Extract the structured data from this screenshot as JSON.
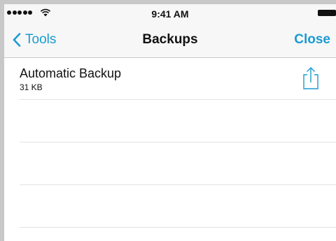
{
  "status_bar": {
    "time": "9:41 AM",
    "signal_icon": "signal-dots-icon",
    "wifi_icon": "wifi-icon",
    "battery_icon": "battery-icon"
  },
  "nav": {
    "back_label": "Tools",
    "back_icon": "chevron-left-icon",
    "title": "Backups",
    "close_label": "Close",
    "accent_color": "#1a9bd1"
  },
  "backups": [
    {
      "name": "Automatic Backup",
      "size": "31 KB",
      "action_icon": "share-icon"
    }
  ]
}
